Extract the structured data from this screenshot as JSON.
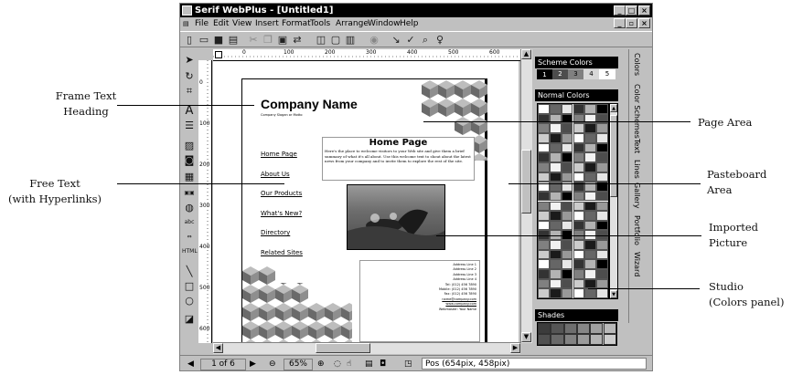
{
  "window": {
    "title": "Serif WebPlus - [Untitled1]",
    "controls": {
      "minimize": "_",
      "maximize": "□",
      "close": "×"
    },
    "doc_controls": {
      "minimize": "_",
      "restore": "▫",
      "close": "×"
    }
  },
  "menu": [
    "File",
    "Edit",
    "View",
    "Insert",
    "Format",
    "Tools",
    "Arrange",
    "Window",
    "Help"
  ],
  "rulers": {
    "h_ticks": [
      "0",
      "100",
      "200",
      "300",
      "400",
      "500",
      "600"
    ],
    "v_ticks": [
      "0",
      "100",
      "200",
      "300",
      "400",
      "500",
      "600"
    ]
  },
  "page": {
    "company_name": "Company Name",
    "slogan": "Company Slogan or Motto",
    "nav": [
      "Home Page",
      "About Us",
      "Our Products",
      "What's New?",
      "Directory",
      "Related Sites"
    ],
    "heading": "Home Page",
    "welcome": "Here's the place to welcome visitors to your Web site and give them a brief summary of what it's all about. Use this welcome text to shout about the latest news from your company and to invite them to explore the rest of the site.",
    "address": [
      "Address Line 1",
      "Address Line 2",
      "Address Line 3",
      "Address Line 4",
      "Tel: (012) 456 7890",
      "Mobile: (012) 456 7890",
      "Fax: (012) 456 7890",
      "name@company.com",
      "www.company.com",
      "Webmaster: Your Name"
    ]
  },
  "studio": {
    "scheme_title": "Scheme Colors",
    "scheme_numbers": [
      "1",
      "2",
      "3",
      "4",
      "5"
    ],
    "normal_title": "Normal Colors",
    "shades_title": "Shades",
    "tabs": [
      "Colors",
      "Color Schemes",
      "Text",
      "Lines",
      "Gallery",
      "Portfolio",
      "Wizard"
    ]
  },
  "status": {
    "page_indicator": "1 of 6",
    "zoom": "65%",
    "position": "Pos (654pix, 458pix)"
  },
  "callouts": {
    "frame_text": [
      "Frame Text",
      "Heading"
    ],
    "free_text": [
      "Free Text",
      "(with Hyperlinks)"
    ],
    "page_area": "Page Area",
    "pasteboard": [
      "Pasteboard",
      "Area"
    ],
    "imported_picture": [
      "Imported",
      "Picture"
    ],
    "studio": [
      "Studio",
      "(Colors panel)"
    ]
  },
  "colors": {
    "titlebar": "#000000",
    "chrome": "#c0c0c0",
    "link": "#000000"
  }
}
